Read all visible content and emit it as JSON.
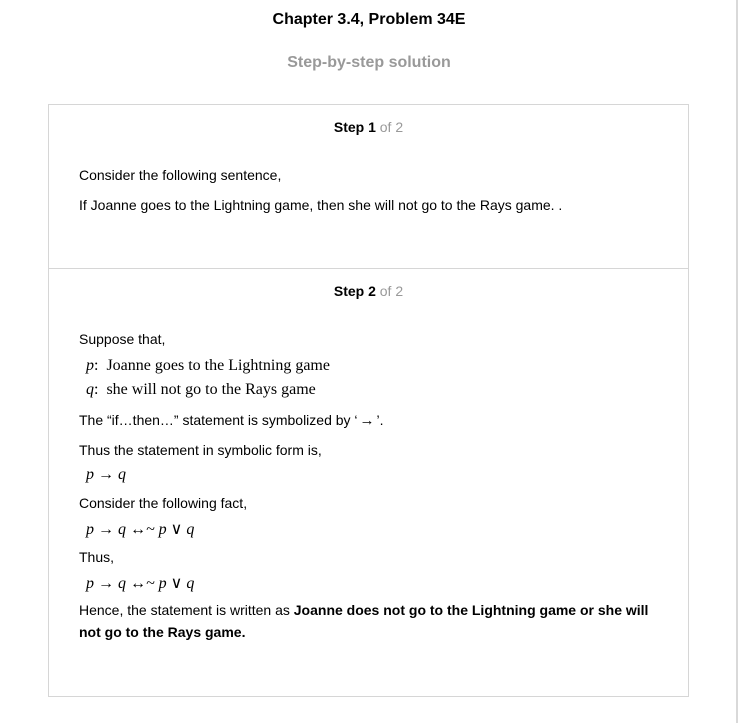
{
  "header": {
    "title": "Chapter 3.4, Problem 34E",
    "subtitle": "Step-by-step solution"
  },
  "steps": [
    {
      "label": "Step 1",
      "of": "of 2",
      "lines": [
        "Consider the following sentence,",
        "If Joanne goes to the Lightning game, then she will not go to the Rays game. ."
      ]
    },
    {
      "label": "Step 2",
      "of": "of 2",
      "suppose": "Suppose that,",
      "p_var": "p",
      "p_def": "Joanne goes to the Lightning game",
      "q_var": "q",
      "q_def": "she will not go to the Rays game",
      "ifthen_pre": "The “if…then…” statement is symbolized by ‘",
      "arrow": "→",
      "ifthen_post": "’.",
      "symbolic_intro": "Thus the statement in symbolic form is,",
      "expr1": "p → q",
      "fact_intro": "Consider the following fact,",
      "expr2": "p → q ↔~ p ∨ q",
      "thus": "Thus,",
      "expr3": "p → q ↔~ p ∨ q",
      "hence_pre": "Hence, the statement is written as ",
      "hence_bold": "Joanne does not go to the Lightning game or she will not go to the Rays game."
    }
  ]
}
